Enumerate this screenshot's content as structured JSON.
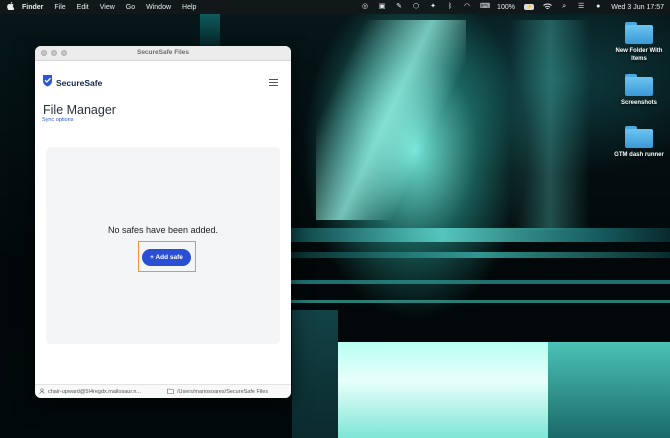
{
  "menubar": {
    "app_name": "Finder",
    "menus": [
      "File",
      "Edit",
      "View",
      "Go",
      "Window",
      "Help"
    ],
    "battery_percent": "100%",
    "battery_badge": "⚡",
    "clock": "Wed 3 Jun  17:57"
  },
  "desktop": {
    "items": [
      {
        "label": "New Folder With Items"
      },
      {
        "label": "Screenshots"
      },
      {
        "label": "GTM dash runner"
      }
    ]
  },
  "window": {
    "title": "SecureSafe Files"
  },
  "app": {
    "brand": "SecureSafe",
    "page_title": "File Manager",
    "sync_link": "Sync options",
    "empty_message": "No safes have been added.",
    "add_button": "+ Add safe",
    "highlight_color": "#f29431",
    "button_color": "#2a4fd2"
  },
  "statusbar": {
    "user": "chair-upward@5I4regdx.mailosaur.n...",
    "path": "/Users/mariosoares/SecureSafe Files"
  }
}
